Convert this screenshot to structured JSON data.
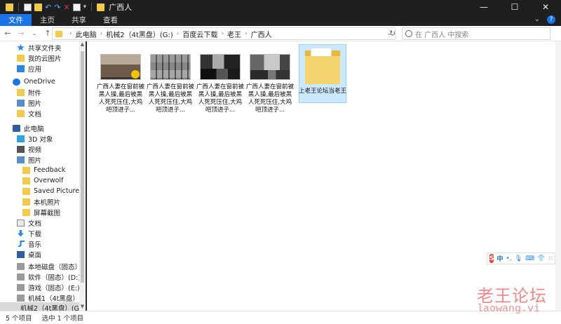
{
  "window": {
    "title": "广西人",
    "controls": [
      "—",
      "☐",
      "✕"
    ]
  },
  "ribbon": {
    "tabs": [
      {
        "label": "文件",
        "active": true
      },
      {
        "label": "主页",
        "active": false
      },
      {
        "label": "共享",
        "active": false
      },
      {
        "label": "查看",
        "active": false
      }
    ],
    "help": "?"
  },
  "address": {
    "crumbs": [
      "此电脑",
      "机械2（4t黑盘）(G:)",
      "百度云下载",
      "老王",
      "广西人"
    ],
    "search_placeholder": "在 广西人 中搜索"
  },
  "navpane": {
    "items": [
      {
        "label": "共享文件夹",
        "icon": "star-icon"
      },
      {
        "label": "我的云图片",
        "icon": "folder-icon"
      },
      {
        "label": "应用",
        "icon": "apps-icon"
      },
      {
        "label": "OneDrive",
        "icon": "cloud-icon"
      },
      {
        "label": "附件",
        "icon": "folder-icon"
      },
      {
        "label": "图片",
        "icon": "image-icon"
      },
      {
        "label": "文档",
        "icon": "folder-icon"
      },
      {
        "label": "此电脑",
        "icon": "pc-icon"
      },
      {
        "label": "3D 对象",
        "icon": "3d-icon"
      },
      {
        "label": "视频",
        "icon": "video-icon"
      },
      {
        "label": "图片",
        "icon": "image-icon"
      },
      {
        "label": "Feedback",
        "icon": "folder-icon"
      },
      {
        "label": "Overwolf",
        "icon": "folder-icon"
      },
      {
        "label": "Saved Pictures",
        "icon": "folder-icon"
      },
      {
        "label": "本机照片",
        "icon": "folder-icon"
      },
      {
        "label": "屏幕截图",
        "icon": "folder-icon"
      },
      {
        "label": "文档",
        "icon": "doc-icon"
      },
      {
        "label": "下载",
        "icon": "download-icon"
      },
      {
        "label": "音乐",
        "icon": "music-icon"
      },
      {
        "label": "桌面",
        "icon": "desktop-icon"
      },
      {
        "label": "本地磁盘（固态）(C:)",
        "icon": "drive-icon"
      },
      {
        "label": "软件（固态）(D:)",
        "icon": "drive-icon"
      },
      {
        "label": "游戏（固态）(E:)",
        "icon": "drive-icon"
      },
      {
        "label": "机械1（4t黑盘）(F:)",
        "icon": "drive-icon"
      },
      {
        "label": "机械2（4t黑盘）(G:)",
        "icon": "drive-icon"
      }
    ]
  },
  "files": [
    {
      "name": "广西人妻在窗前被黑人操,最后被黑人死死压住,大鸡吧顶进子...",
      "type": "video"
    },
    {
      "name": "广西人妻在窗前被黑人操,最后被黑人死死压住,大鸡吧顶进子...",
      "type": "video"
    },
    {
      "name": "广西人妻在窗前被黑人操,最后被黑人死死压住,大鸡吧顶进子...",
      "type": "video"
    },
    {
      "name": "广西人妻在窗前被黑人操,最后被黑人死死压住,大鸡吧顶进子...",
      "type": "video"
    },
    {
      "name": "上老王论坛当老王",
      "type": "folder"
    }
  ],
  "status": {
    "count": "5 个项目",
    "selected": "选中 1 个项目"
  },
  "ime": {
    "logo": "S",
    "mode": "中",
    "punct": "•,",
    "mic": "🎙",
    "keyboard": "⌨",
    "shirt": "👕",
    "grid": "⁙"
  },
  "watermark": {
    "text": "老王论坛",
    "url": "laowang.vi"
  }
}
